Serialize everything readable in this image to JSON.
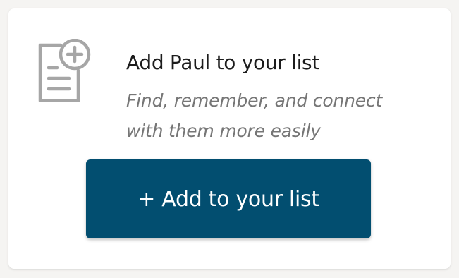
{
  "card": {
    "icon": "add-to-list-icon",
    "title": "Add Paul to your list",
    "subtitle": "Find, remember, and connect with them more easily",
    "button_label": "+ Add to your list"
  },
  "colors": {
    "button_background": "#024e70",
    "button_text": "#ffffff",
    "title_text": "#1c1c1c",
    "subtitle_text": "#767676",
    "icon_stroke": "#a6a6a6"
  }
}
